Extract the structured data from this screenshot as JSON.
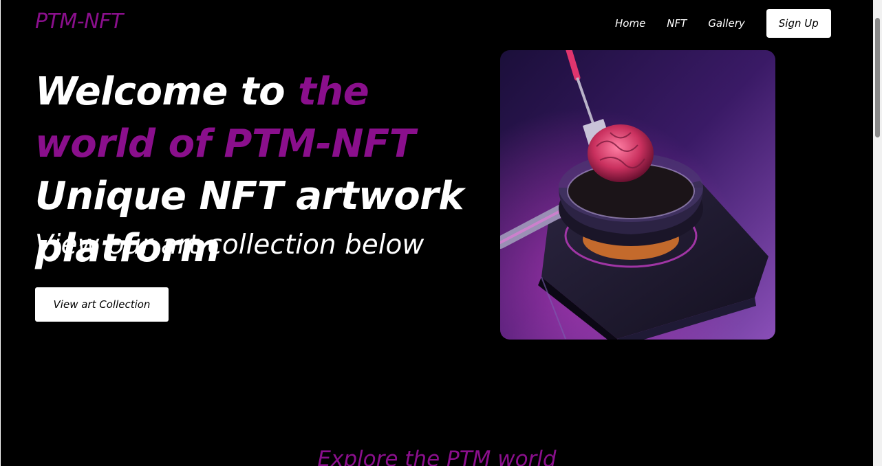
{
  "header": {
    "logo": "PTM-NFT",
    "nav": [
      {
        "label": "Home"
      },
      {
        "label": "NFT"
      },
      {
        "label": "Gallery"
      }
    ],
    "signup_label": "Sign Up"
  },
  "hero": {
    "title_part1": "Welcome to ",
    "title_accent": "the world of PTM-NFT",
    "title_part2": " Unique NFT artwork platform",
    "subtitle": "View our art collection below",
    "cta_label": "View art Collection",
    "image_subject": "brain-in-frying-pan-artwork"
  },
  "section": {
    "explore_title": "Explore the PTM world"
  },
  "colors": {
    "background": "#000000",
    "accent": "#8a0f8c",
    "text": "#ffffff"
  }
}
